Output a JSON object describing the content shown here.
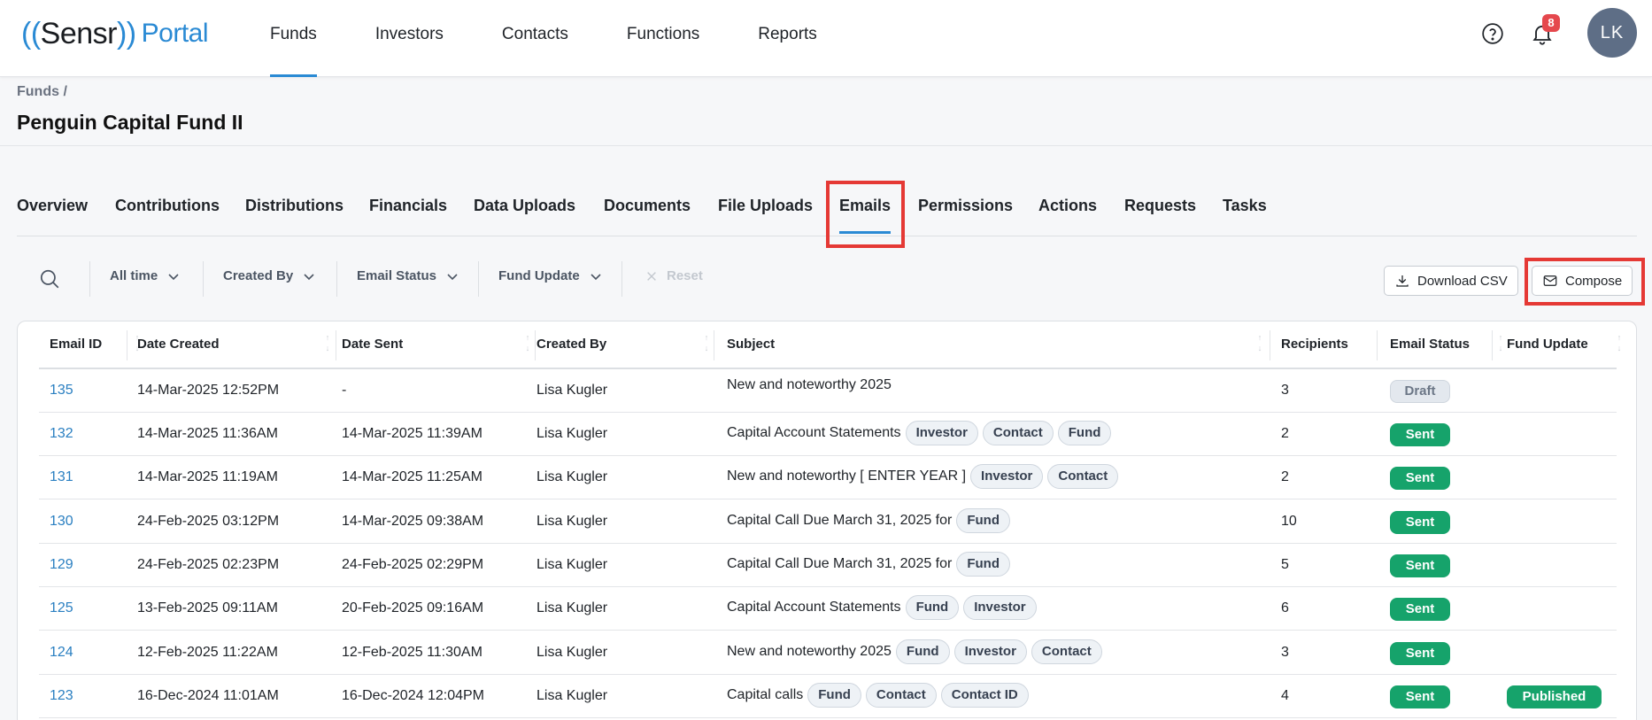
{
  "logo": {
    "open_parens": "((",
    "brand": "Sensr",
    "close_parens": "))",
    "product": "Portal"
  },
  "nav": {
    "items": [
      "Funds",
      "Investors",
      "Contacts",
      "Functions",
      "Reports"
    ],
    "active": "Funds"
  },
  "notifications": {
    "count": "8"
  },
  "user": {
    "initials": "LK"
  },
  "breadcrumb": "Funds /",
  "page_title": "Penguin Capital Fund II",
  "tabs": [
    "Overview",
    "Contributions",
    "Distributions",
    "Financials",
    "Data Uploads",
    "Documents",
    "File Uploads",
    "Emails",
    "Permissions",
    "Actions",
    "Requests",
    "Tasks"
  ],
  "active_tab": "Emails",
  "filters": {
    "time": "All time",
    "created_by": "Created By",
    "email_status": "Email Status",
    "fund_update": "Fund Update",
    "reset": "Reset"
  },
  "actions": {
    "download_csv": "Download CSV",
    "compose": "Compose"
  },
  "table": {
    "columns": [
      "Email ID",
      "Date Created",
      "Date Sent",
      "Created By",
      "Subject",
      "Recipients",
      "Email Status",
      "Fund Update"
    ],
    "rows": [
      {
        "id": "135",
        "created": "14-Mar-2025 12:52PM",
        "sent": "-",
        "by": "Lisa Kugler",
        "subject": "New and noteworthy 2025",
        "tags": [],
        "recipients": "3",
        "status": "Draft",
        "fund_update": ""
      },
      {
        "id": "132",
        "created": "14-Mar-2025 11:36AM",
        "sent": "14-Mar-2025 11:39AM",
        "by": "Lisa Kugler",
        "subject": "Capital Account Statements",
        "tags": [
          "Investor",
          "Contact",
          "Fund"
        ],
        "recipients": "2",
        "status": "Sent",
        "fund_update": ""
      },
      {
        "id": "131",
        "created": "14-Mar-2025 11:19AM",
        "sent": "14-Mar-2025 11:25AM",
        "by": "Lisa Kugler",
        "subject": "New and noteworthy [ ENTER YEAR ]",
        "tags": [
          "Investor",
          "Contact"
        ],
        "recipients": "2",
        "status": "Sent",
        "fund_update": ""
      },
      {
        "id": "130",
        "created": "24-Feb-2025 03:12PM",
        "sent": "14-Mar-2025 09:38AM",
        "by": "Lisa Kugler",
        "subject": "Capital Call Due March 31, 2025 for",
        "tags": [
          "Fund"
        ],
        "recipients": "10",
        "status": "Sent",
        "fund_update": ""
      },
      {
        "id": "129",
        "created": "24-Feb-2025 02:23PM",
        "sent": "24-Feb-2025 02:29PM",
        "by": "Lisa Kugler",
        "subject": "Capital Call Due March 31, 2025 for",
        "tags": [
          "Fund"
        ],
        "recipients": "5",
        "status": "Sent",
        "fund_update": ""
      },
      {
        "id": "125",
        "created": "13-Feb-2025 09:11AM",
        "sent": "20-Feb-2025 09:16AM",
        "by": "Lisa Kugler",
        "subject": "Capital Account Statements",
        "tags": [
          "Fund",
          "Investor"
        ],
        "recipients": "6",
        "status": "Sent",
        "fund_update": ""
      },
      {
        "id": "124",
        "created": "12-Feb-2025 11:22AM",
        "sent": "12-Feb-2025 11:30AM",
        "by": "Lisa Kugler",
        "subject": "New and noteworthy 2025",
        "tags": [
          "Fund",
          "Investor",
          "Contact"
        ],
        "recipients": "3",
        "status": "Sent",
        "fund_update": ""
      },
      {
        "id": "123",
        "created": "16-Dec-2024 11:01AM",
        "sent": "16-Dec-2024 12:04PM",
        "by": "Lisa Kugler",
        "subject": "Capital calls",
        "tags": [
          "Fund",
          "Contact",
          "Contact ID"
        ],
        "recipients": "4",
        "status": "Sent",
        "fund_update": "Published"
      }
    ]
  },
  "colors": {
    "accent": "#2a8ad4",
    "sent": "#16a36b",
    "highlight": "#e53935",
    "badge": "#e5484d"
  }
}
